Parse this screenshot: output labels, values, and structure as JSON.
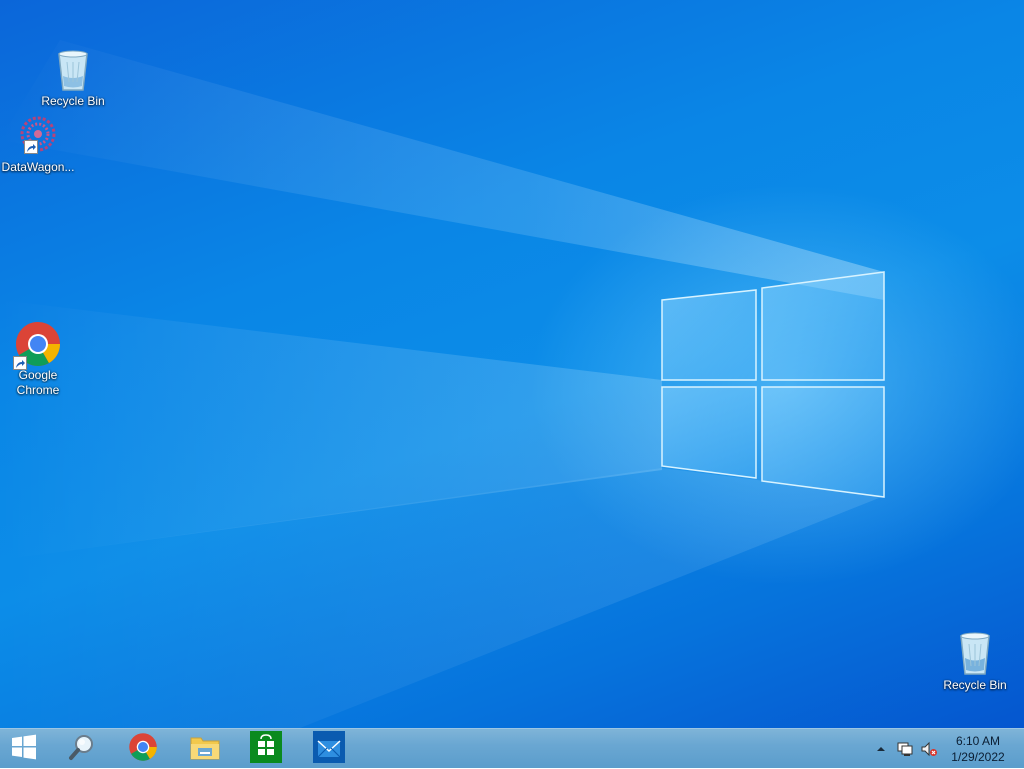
{
  "desktop": {
    "icons": [
      {
        "label": "Recycle Bin",
        "icon": "recycle-bin-icon"
      },
      {
        "label": "DataWagon...",
        "icon": "datawagon-icon"
      },
      {
        "label": "Google Chrome",
        "label_line1": "Google",
        "label_line2": "Chrome",
        "icon": "chrome-icon"
      },
      {
        "label": "Recycle Bin",
        "icon": "recycle-bin-icon"
      }
    ]
  },
  "taskbar": {
    "pinned": [
      {
        "name": "start",
        "icon": "windows-start-icon"
      },
      {
        "name": "search",
        "icon": "search-icon"
      },
      {
        "name": "chrome",
        "icon": "chrome-icon"
      },
      {
        "name": "file-explorer",
        "icon": "folder-icon"
      },
      {
        "name": "store",
        "icon": "store-icon"
      },
      {
        "name": "mail",
        "icon": "mail-icon"
      }
    ],
    "tray": {
      "time": "6:10 AM",
      "date": "1/29/2022"
    }
  },
  "colors": {
    "desktop_top": "#0b66d9",
    "desktop_mid": "#0c8de8",
    "taskbar": "#6aa7d2"
  }
}
